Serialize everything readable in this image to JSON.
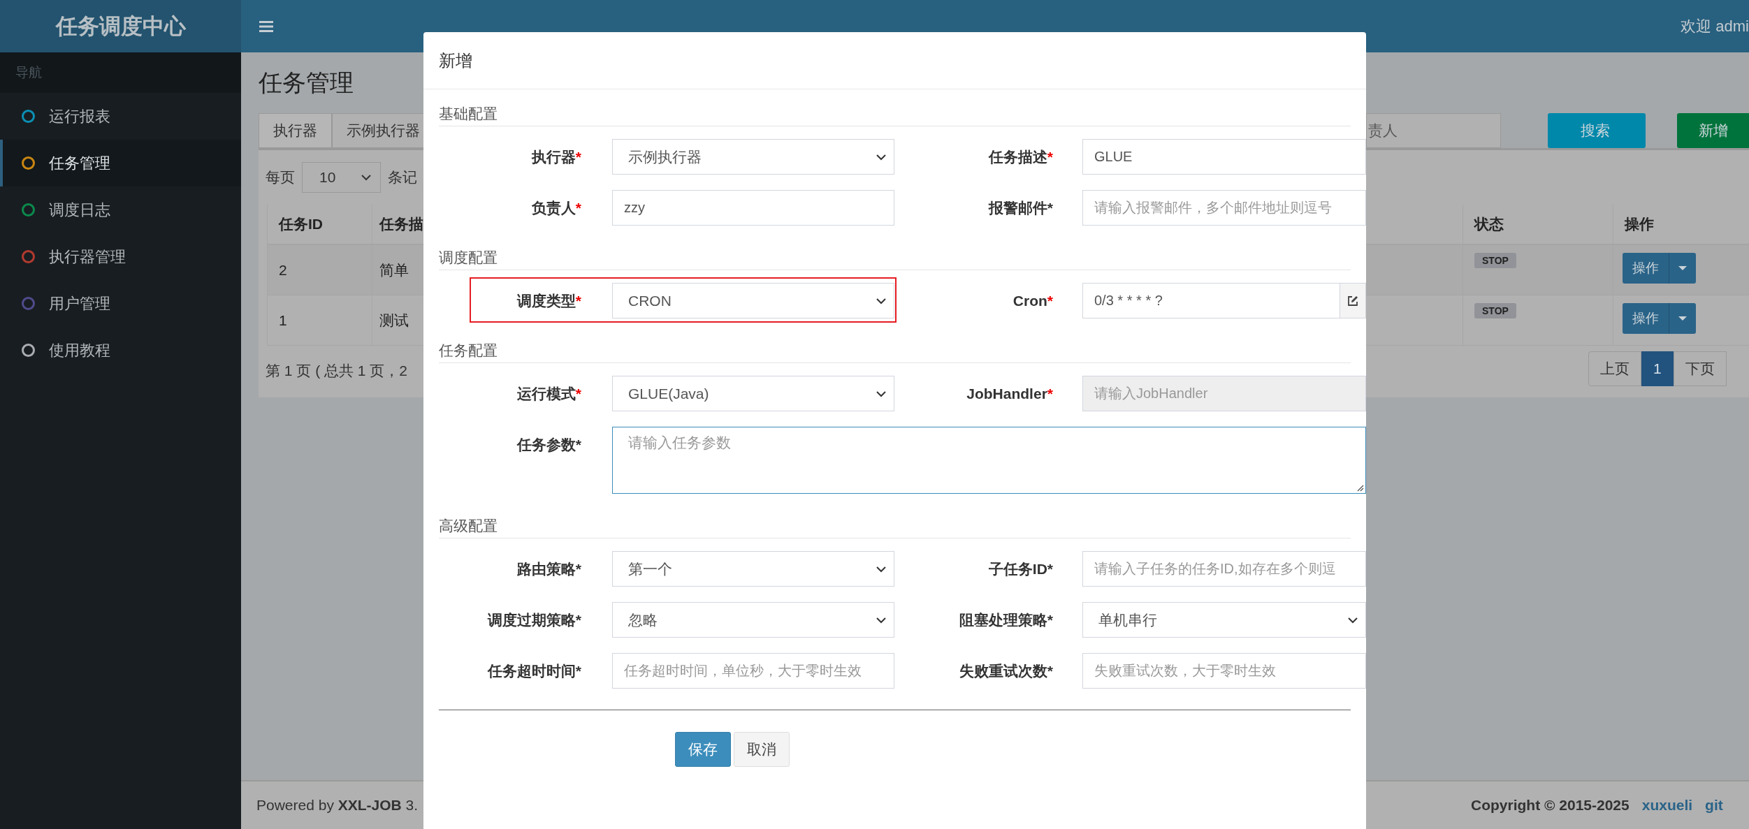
{
  "sidebar": {
    "logo": "任务调度中心",
    "nav_header": "导航",
    "items": [
      {
        "label": "运行报表",
        "color": "#0b8fb3",
        "selected": false
      },
      {
        "label": "任务管理",
        "color": "#c98612",
        "selected": true
      },
      {
        "label": "调度日志",
        "color": "#0b8a4c",
        "selected": false
      },
      {
        "label": "执行器管理",
        "color": "#b23a2f",
        "selected": false
      },
      {
        "label": "用户管理",
        "color": "#4f4b8c",
        "selected": false
      },
      {
        "label": "使用教程",
        "color": "#a9acb0",
        "selected": false
      }
    ]
  },
  "topbar": {
    "welcome": "欢迎 admi"
  },
  "page": {
    "title": "任务管理",
    "executor_label": "执行器",
    "executor_value": "示例执行器",
    "search_placeholder": "责人",
    "buttons": [
      {
        "label": "搜索",
        "kind": "search"
      },
      {
        "label": "新增",
        "kind": "add"
      }
    ]
  },
  "table": {
    "page_size_label": "每页",
    "page_size": "10",
    "page_size_suffix": "条记",
    "columns": [
      "任务ID",
      "任务描",
      "状态",
      "操作"
    ],
    "rows": [
      {
        "cells": [
          "2",
          "简单"
        ],
        "status": "STOP",
        "action": "操作"
      },
      {
        "cells": [
          "1",
          "测试"
        ],
        "status": "STOP",
        "action": "操作"
      }
    ],
    "summary": "第 1 页 ( 总共 1 页，2",
    "pager": [
      {
        "label": "上页",
        "selected": false
      },
      {
        "label": "1",
        "selected": true
      },
      {
        "label": "下页",
        "selected": false
      }
    ]
  },
  "footer": {
    "powered": "Powered by **XXL-JOB** 3.",
    "copyright": "Copyright © 2015-2025",
    "links": [
      "xuxueli",
      "git"
    ]
  },
  "dialog": {
    "title": "新增",
    "sections": [
      {
        "title": "基础配置",
        "rows": [
          [
            {
              "label": "执行器",
              "star": "*",
              "required": true,
              "kind": "select",
              "value": "示例执行器"
            },
            {
              "label": "任务描述",
              "star": "*",
              "required": true,
              "kind": "input",
              "value": "GLUE",
              "disabled": false
            }
          ],
          [
            {
              "label": "负责人",
              "star": "*",
              "required": true,
              "kind": "input",
              "value": "zzy",
              "disabled": false
            },
            {
              "label": "报警邮件",
              "star": "*",
              "required": false,
              "kind": "input",
              "placeholder": "请输入报警邮件，多个邮件地址则逗号",
              "disabled": false
            }
          ]
        ]
      },
      {
        "title": "调度配置",
        "rows": [
          [
            {
              "label": "调度类型",
              "star": "*",
              "required": true,
              "kind": "select",
              "value": "CRON",
              "highlighted": true
            },
            {
              "label": "Cron",
              "star": "*",
              "required": true,
              "kind": "addon-input",
              "value": "0/3 * * * * ?"
            }
          ]
        ]
      },
      {
        "title": "任务配置",
        "rows": [
          [
            {
              "label": "运行模式",
              "star": "*",
              "required": true,
              "kind": "select",
              "value": "GLUE(Java)"
            },
            {
              "label": "JobHandler",
              "star": "*",
              "required": true,
              "kind": "input",
              "placeholder": "请输入JobHandler",
              "disabled": true
            }
          ],
          [
            {
              "label": "任务参数",
              "star": "*",
              "required": false,
              "kind": "textarea",
              "placeholder": "请输入任务参数",
              "focused": true
            }
          ]
        ]
      },
      {
        "title": "高级配置",
        "rows": [
          [
            {
              "label": "路由策略",
              "star": "*",
              "required": false,
              "kind": "select",
              "value": "第一个"
            },
            {
              "label": "子任务ID",
              "star": "*",
              "required": false,
              "kind": "input",
              "placeholder": "请输入子任务的任务ID,如存在多个则逗",
              "disabled": false
            }
          ],
          [
            {
              "label": "调度过期策略",
              "star": "*",
              "required": false,
              "kind": "select",
              "value": "忽略"
            },
            {
              "label": "阻塞处理策略",
              "star": "*",
              "required": false,
              "kind": "select",
              "value": "单机串行"
            }
          ],
          [
            {
              "label": "任务超时时间",
              "star": "*",
              "required": false,
              "kind": "input",
              "placeholder": "任务超时时间，单位秒，大于零时生效",
              "disabled": false
            },
            {
              "label": "失败重试次数",
              "star": "*",
              "required": false,
              "kind": "input",
              "placeholder": "失败重试次数，大于零时生效",
              "disabled": false
            }
          ]
        ]
      }
    ],
    "buttons": [
      {
        "label": "保存",
        "kind": "primary"
      },
      {
        "label": "取消",
        "kind": "default"
      }
    ]
  }
}
